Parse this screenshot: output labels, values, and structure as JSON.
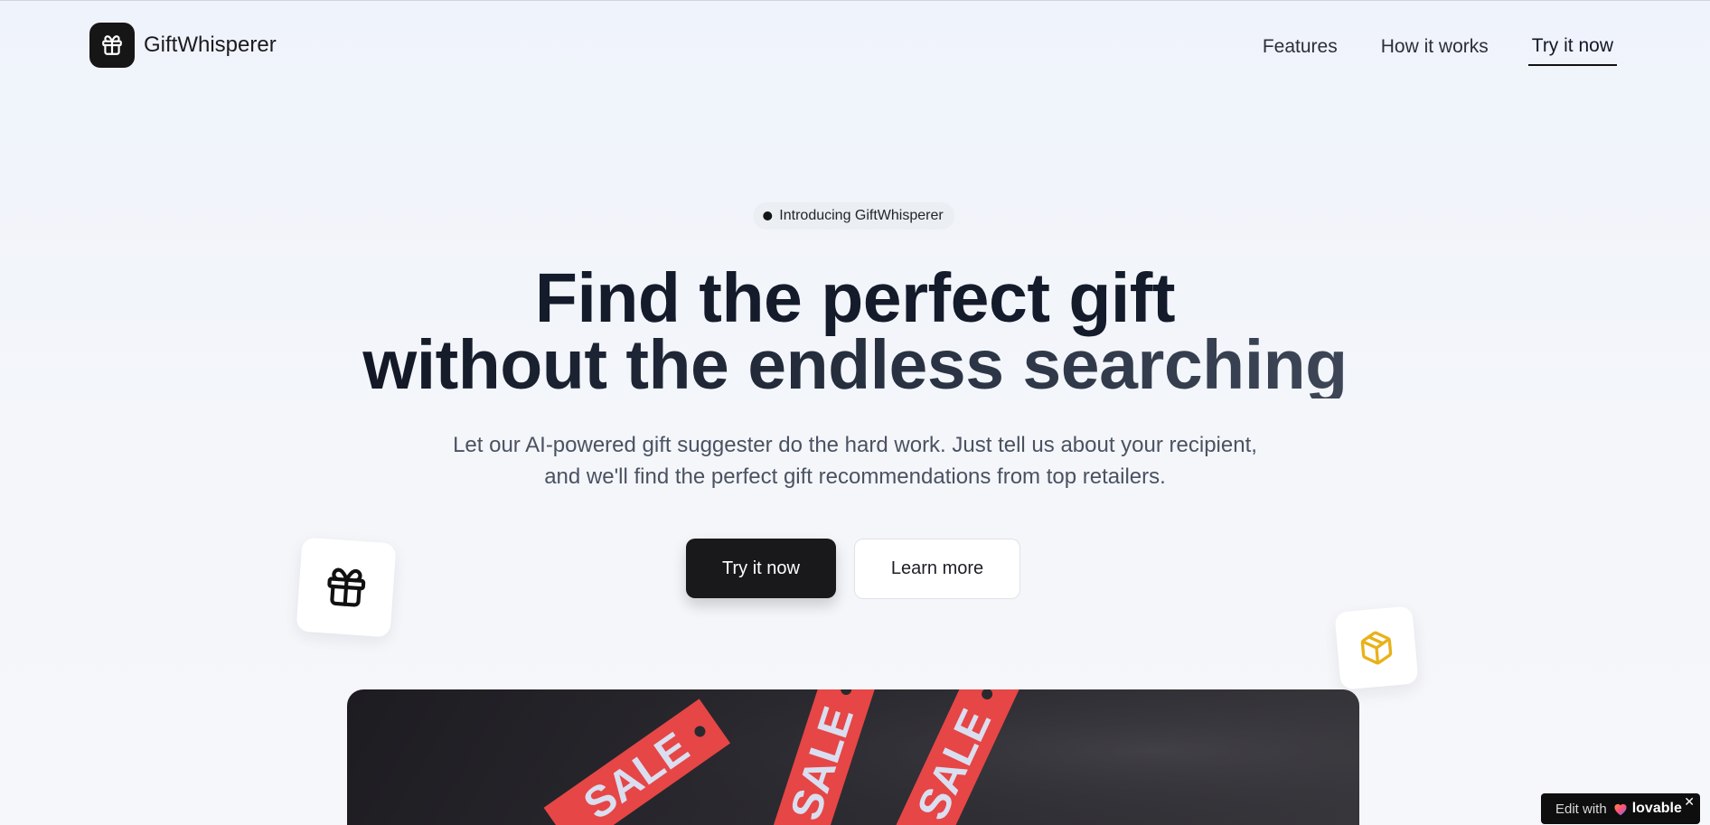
{
  "header": {
    "brand": "GiftWhisperer",
    "nav": [
      {
        "label": "Features"
      },
      {
        "label": "How it works"
      },
      {
        "label": "Try it now",
        "active": true
      }
    ]
  },
  "hero": {
    "badge": "Introducing GiftWhisperer",
    "headline_line1": "Find the perfect gift",
    "headline_line2": "without the endless searching",
    "subtext": "Let our AI-powered gift suggester do the hard work. Just tell us about your recipient, and we'll find the perfect gift recommendations from top retailers.",
    "primary_cta": "Try it now",
    "secondary_cta": "Learn more"
  },
  "image_tags": [
    "SALE",
    "SALE",
    "SALE"
  ],
  "lovable_badge": {
    "edit_label": "Edit with",
    "brand": "lovable",
    "close": "✕"
  },
  "colors": {
    "primary": "#19191b",
    "accent_yellow": "#e8b21a",
    "sale_red": "#e64646"
  },
  "icons": {
    "logo": "gift-icon",
    "float_left": "gift-icon",
    "float_right": "box-icon"
  }
}
